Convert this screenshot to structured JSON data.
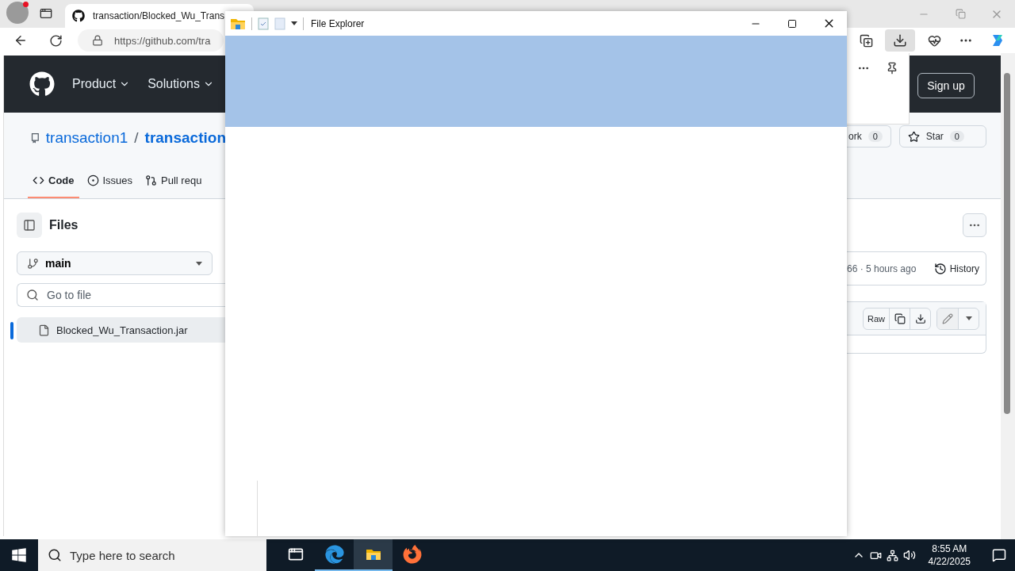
{
  "browser": {
    "tab": {
      "title": "transaction/Blocked_Wu_Trans",
      "selected": true
    },
    "url": "https://github.com/tra"
  },
  "github": {
    "nav": [
      "Product",
      "Solutions"
    ],
    "sign_up": "Sign up",
    "owner": "transaction1",
    "separator": "/",
    "repo": "transaction",
    "fork": {
      "label": "ork",
      "count": "0"
    },
    "star": {
      "label": "Star",
      "count": "0"
    },
    "tabs": [
      {
        "kind": "code",
        "label": "Code",
        "selected": true
      },
      {
        "kind": "issues",
        "label": "Issues",
        "selected": false
      },
      {
        "kind": "pulls",
        "label": "Pull requ",
        "selected": false
      }
    ],
    "files_title": "Files",
    "branch": "main",
    "search_placeholder": "Go to file",
    "files": [
      {
        "name": "Blocked_Wu_Transaction.jar",
        "selected": true
      }
    ],
    "commit_info": "66 · 5 hours ago",
    "history": "History",
    "raw": "Raw"
  },
  "explorer": {
    "title": "File Explorer"
  },
  "taskbar": {
    "search_placeholder": "Type here to search",
    "apps": [
      {
        "kind": "task-view",
        "running": false,
        "selected": false
      },
      {
        "kind": "edge",
        "running": true,
        "selected": false
      },
      {
        "kind": "explorer",
        "running": true,
        "selected": true
      },
      {
        "kind": "firefox",
        "running": false,
        "selected": false
      }
    ],
    "time": "8:55 AM",
    "date": "4/22/2025"
  }
}
